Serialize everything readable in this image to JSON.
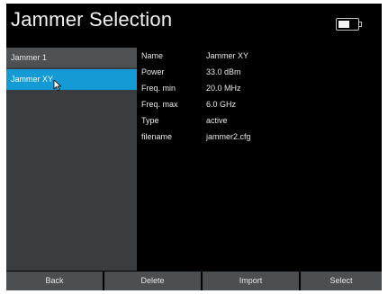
{
  "header": {
    "title": "Jammer Selection",
    "battery_level": 0.6
  },
  "list": {
    "header_label": "Jammer 1",
    "selected_item": "Jammer XY"
  },
  "details": [
    {
      "label": "Name",
      "value": "Jammer XY"
    },
    {
      "label": "Power",
      "value": "33.0 dBm"
    },
    {
      "label": "Freq. min",
      "value": "20.0 MHz"
    },
    {
      "label": "Freq. max",
      "value": "6.0 GHz"
    },
    {
      "label": "Type",
      "value": "active"
    },
    {
      "label": "filename",
      "value": "jammer2.cfg"
    }
  ],
  "softkeys": {
    "back": "Back",
    "delete": "Delete",
    "import": "Import",
    "select": "Select"
  },
  "colors": {
    "selection": "#149bd6",
    "panel": "#3a3d40",
    "softkey": "#4c4f52",
    "background": "#000000"
  }
}
